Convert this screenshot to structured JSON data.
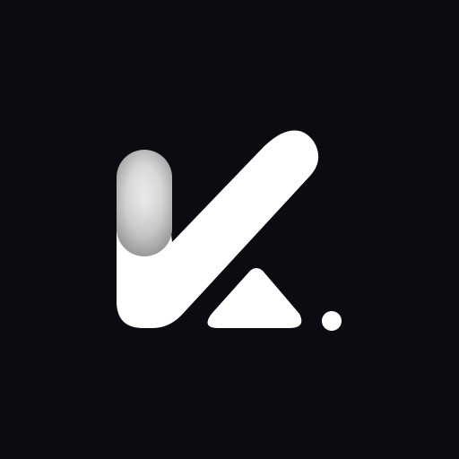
{
  "logo": {
    "name": "K-mark",
    "background_color": "#0d0b12",
    "mark_color": "#ffffff",
    "pill_gradient_center": "#f1f1f1",
    "pill_gradient_edge": "#9a9a9a"
  }
}
